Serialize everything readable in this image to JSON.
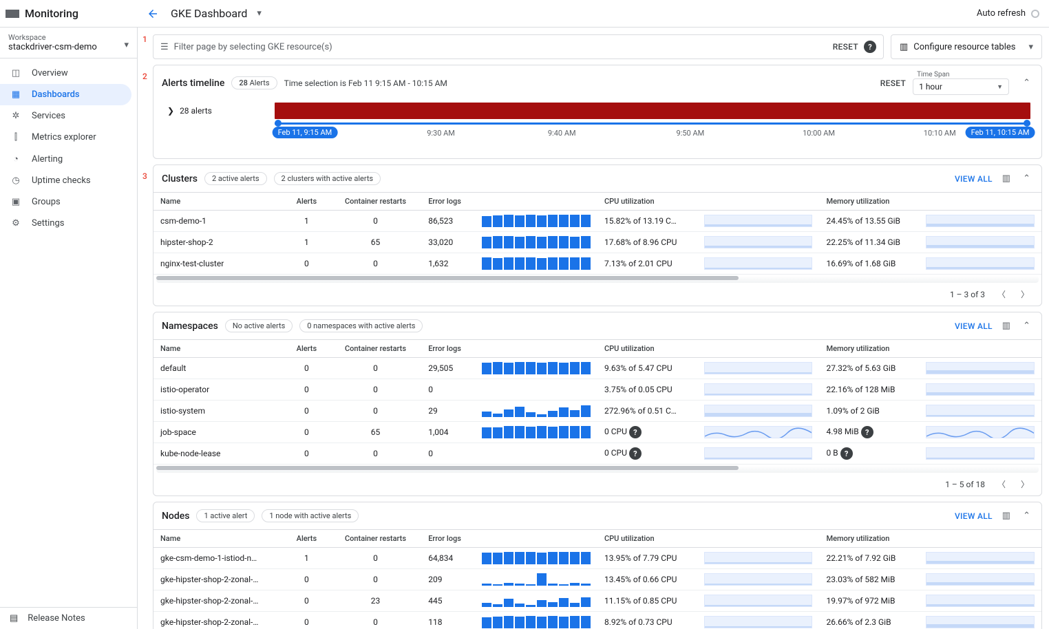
{
  "brand": "Monitoring",
  "page_title": "GKE Dashboard",
  "auto_refresh": "Auto refresh",
  "workspace": {
    "label": "Workspace",
    "value": "stackdriver-csm-demo"
  },
  "nav": [
    {
      "icon": "overview-icon",
      "label": "Overview"
    },
    {
      "icon": "dashboards-icon",
      "label": "Dashboards",
      "active": true
    },
    {
      "icon": "services-icon",
      "label": "Services"
    },
    {
      "icon": "metrics-icon",
      "label": "Metrics explorer"
    },
    {
      "icon": "alerting-icon",
      "label": "Alerting"
    },
    {
      "icon": "uptime-icon",
      "label": "Uptime checks"
    },
    {
      "icon": "groups-icon",
      "label": "Groups"
    },
    {
      "icon": "settings-icon",
      "label": "Settings"
    }
  ],
  "release_notes": "Release Notes",
  "filter": {
    "placeholder": "Filter page by selecting GKE resource(s)",
    "reset": "RESET",
    "configure": "Configure resource tables"
  },
  "annotations": {
    "filter": "1",
    "alerts": "2",
    "clusters": "3"
  },
  "alerts_card": {
    "title": "Alerts timeline",
    "badge_count": 28,
    "badge_label": "Alerts",
    "subtext": "Time selection is Feb 11 9:15 AM - 10:15 AM",
    "reset": "RESET",
    "timespan_label": "Time Span",
    "timespan_value": "1 hour",
    "alerts_expand": "28 alerts",
    "ticks": [
      "9:30 AM",
      "9:40 AM",
      "9:50 AM",
      "10:00 AM",
      "10:10 AM"
    ],
    "pill_start": "Feb 11, 9:15 AM",
    "pill_end": "Feb 11, 10:15 AM"
  },
  "columns": {
    "name": "Name",
    "alerts": "Alerts",
    "restarts": "Container restarts",
    "errlogs": "Error logs",
    "cpu": "CPU utilization",
    "mem": "Memory utilization"
  },
  "view_all": "VIEW ALL",
  "sections": {
    "clusters": {
      "title": "Clusters",
      "chips": [
        "2 active alerts",
        "2 clusters with active alerts"
      ],
      "rows": [
        {
          "name": "csm-demo-1",
          "alerts": 1,
          "restarts": 0,
          "errlogs": "86,523",
          "spark_err": [
            16,
            17,
            18,
            17,
            18,
            17,
            18,
            18,
            18,
            18
          ],
          "cpu": "15.82% of 13.19 C…",
          "spark_cpu_fill": 14,
          "mem": "24.45% of 13.55 GiB",
          "spark_mem_fill": 22
        },
        {
          "name": "hipster-shop-2",
          "alerts": 1,
          "restarts": 65,
          "errlogs": "33,020",
          "spark_err": [
            17,
            18,
            18,
            17,
            18,
            17,
            18,
            18,
            17,
            18
          ],
          "cpu": "17.68% of 8.96 CPU",
          "spark_cpu_fill": 16,
          "mem": "22.25% of 11.34 GiB",
          "spark_mem_fill": 21
        },
        {
          "name": "nginx-test-cluster",
          "alerts": 0,
          "restarts": 0,
          "errlogs": "1,632",
          "spark_err": [
            18,
            17,
            18,
            18,
            18,
            17,
            18,
            18,
            18,
            18
          ],
          "cpu": "7.13% of 2.01 CPU",
          "spark_cpu_fill": 7,
          "mem": "16.69% of 1.68 GiB",
          "spark_mem_fill": 15
        }
      ],
      "pager": "1 – 3 of 3"
    },
    "namespaces": {
      "title": "Namespaces",
      "chips": [
        "No active alerts",
        "0 namespaces with active alerts"
      ],
      "rows": [
        {
          "name": "default",
          "alerts": 0,
          "restarts": 0,
          "errlogs": "29,505",
          "spark_err": [
            17,
            18,
            17,
            18,
            18,
            17,
            18,
            17,
            18,
            18
          ],
          "cpu": "9.63% of 5.47 CPU",
          "spark_cpu_fill": 10,
          "mem": "27.32% of 5.63 GiB",
          "spark_mem_fill": 26
        },
        {
          "name": "istio-operator",
          "alerts": 0,
          "restarts": 0,
          "errlogs": "0",
          "spark_err": [
            0,
            0,
            0,
            0,
            0,
            0,
            0,
            0,
            0,
            0
          ],
          "cpu": "3.75% of 0.05 CPU",
          "spark_cpu_fill": 4,
          "mem": "22.16% of 128 MiB",
          "spark_mem_fill": 21
        },
        {
          "name": "istio-system",
          "alerts": 0,
          "restarts": 0,
          "errlogs": "29",
          "spark_err": [
            8,
            5,
            11,
            15,
            7,
            4,
            9,
            14,
            10,
            17
          ],
          "cpu": "272.96% of 0.51 C…",
          "spark_cpu_fill": 30,
          "mem": "1.09% of 2 GiB",
          "spark_mem_fill": 2
        },
        {
          "name": "job-space",
          "alerts": 0,
          "restarts": 65,
          "errlogs": "1,004",
          "spark_err": [
            16,
            16,
            18,
            18,
            17,
            18,
            17,
            18,
            18,
            18
          ],
          "cpu": "0 CPU",
          "cpu_help": true,
          "spark_cpu_fill": 0,
          "cpu_wavy": true,
          "mem": "4.98 MiB",
          "mem_help": true,
          "spark_mem_fill": 0,
          "mem_wavy": true
        },
        {
          "name": "kube-node-lease",
          "alerts": 0,
          "restarts": 0,
          "errlogs": "0",
          "spark_err": [
            0,
            0,
            0,
            0,
            0,
            0,
            0,
            0,
            0,
            0
          ],
          "cpu": "0 CPU",
          "cpu_help": true,
          "spark_cpu_fill": 0,
          "mem": "0 B",
          "mem_help": true,
          "spark_mem_fill": 0
        }
      ],
      "pager": "1 – 5 of 18"
    },
    "nodes": {
      "title": "Nodes",
      "chips": [
        "1 active alert",
        "1 node with active alerts"
      ],
      "rows": [
        {
          "name": "gke-csm-demo-1-istiod-n…",
          "alerts": 1,
          "restarts": 0,
          "errlogs": "64,834",
          "spark_err": [
            17,
            17,
            18,
            18,
            18,
            17,
            18,
            18,
            18,
            18
          ],
          "cpu": "13.95% of 7.79 CPU",
          "spark_cpu_fill": 13,
          "mem": "22.21% of 7.92 GiB",
          "spark_mem_fill": 21
        },
        {
          "name": "gke-hipster-shop-2-zonal-…",
          "alerts": 0,
          "restarts": 0,
          "errlogs": "209",
          "spark_err": [
            3,
            2,
            4,
            3,
            2,
            18,
            3,
            2,
            4,
            3
          ],
          "cpu": "13.45% of 0.66 CPU",
          "spark_cpu_fill": 13,
          "mem": "23.03% of 582 MiB",
          "spark_mem_fill": 22
        },
        {
          "name": "gke-hipster-shop-2-zonal-…",
          "alerts": 0,
          "restarts": 23,
          "errlogs": "445",
          "spark_err": [
            6,
            4,
            12,
            5,
            3,
            10,
            7,
            13,
            6,
            14
          ],
          "cpu": "11.15% of 0.85 CPU",
          "spark_cpu_fill": 11,
          "mem": "19.97% of 972 MiB",
          "spark_mem_fill": 19
        },
        {
          "name": "gke-hipster-shop-2-zonal-…",
          "alerts": 0,
          "restarts": 0,
          "errlogs": "118",
          "spark_err": [
            16,
            17,
            18,
            17,
            18,
            17,
            18,
            17,
            18,
            18
          ],
          "cpu": "8.92% of 0.73 CPU",
          "spark_cpu_fill": 9,
          "mem": "26.66% of 2.3 GiB",
          "spark_mem_fill": 25
        }
      ]
    }
  }
}
